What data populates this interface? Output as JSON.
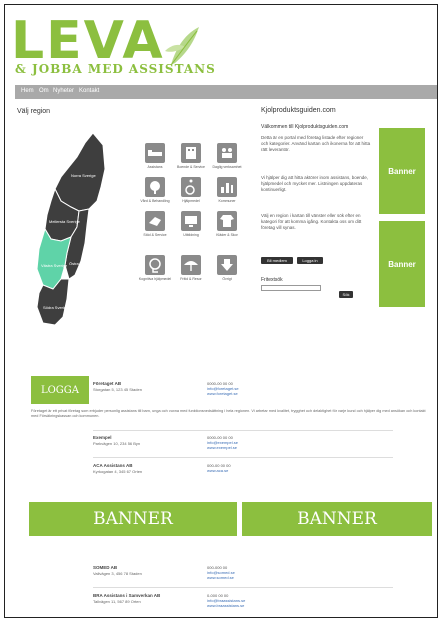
{
  "header": {
    "logo_main": "LEVA",
    "logo_sub": "& JOBBA MED ASSISTANS"
  },
  "nav": {
    "items": [
      "Hem",
      "Om",
      "Nyheter",
      "Kontakt"
    ]
  },
  "left": {
    "region_title": "Välj region",
    "regions": [
      "Norra Sverige",
      "Mellersta Sverige",
      "Västra Sverige",
      "Östra Sverige",
      "Södra Sverige"
    ]
  },
  "icons": [
    {
      "name": "bed-icon",
      "label": "Assistans"
    },
    {
      "name": "building-icon",
      "label": "Boende & Service"
    },
    {
      "name": "people-icon",
      "label": "Daglig verksamhet"
    },
    {
      "name": "medical-icon",
      "label": "Vård & Behandling"
    },
    {
      "name": "wheelchair-icon",
      "label": "Hjälpmedel"
    },
    {
      "name": "chart-icon",
      "label": "Kommuner"
    },
    {
      "name": "hand-icon",
      "label": "Stöd & Service"
    },
    {
      "name": "computer-icon",
      "label": "Utbildning"
    },
    {
      "name": "shirt-icon",
      "label": "Kläder & Skor"
    },
    {
      "name": "head-icon",
      "label": "Kognitiva hjälpmedel"
    },
    {
      "name": "umbrella-icon",
      "label": "Fritid & Resor"
    },
    {
      "name": "misc-icon",
      "label": "Övrigt"
    }
  ],
  "right": {
    "site_title": "Kjolproduktsguiden.com",
    "welcome": "Välkommen till Kjolproduktsguiden.com",
    "paragraphs": [
      "Detta är en portal med företag listade efter regioner och kategorier. Använd kartan och ikonerna för att hitta rätt leverantör.",
      "Vi hjälper dig att hitta aktörer inom assistans, boende, hjälpmedel och mycket mer. Listningen uppdateras kontinuerligt.",
      "Välj en region i kartan till vänster eller sök efter en kategori för att komma igång. Kontakta oss om ditt företag vill synas."
    ],
    "btn_register": "Bli medlem",
    "btn_login": "Logga in",
    "search_label": "Fritextsök",
    "search_btn": "Sök",
    "banner1": "Banner",
    "banner2": "Banner"
  },
  "listings": {
    "logo_box": "LOGGA",
    "items": [
      {
        "name": "Företaget AB",
        "addr": "Storgatan 5, 123 45 Staden",
        "phone": "0000-00 00 00",
        "email": "info@foretaget.se",
        "web": "www.foretaget.se",
        "desc": "Företaget är ett privat företag som erbjuder personlig assistans till barn, unga och vuxna med funktionsnedsättning i hela regionen. Vi arbetar med kvalitet, trygghet och delaktighet för varje kund och hjälper dig med ansökan och kontakt med Försäkringskassan och kommunen."
      },
      {
        "name": "Exempel",
        "addr": "Parkvägen 10, 234 56 Byn",
        "phone": "0000-00 00 00",
        "email": "info@exempel.se",
        "web": "www.exempel.se",
        "desc": ""
      },
      {
        "name": "ACA Assistans AB",
        "addr": "Kyrkogatan 4, 345 67 Orten",
        "phone": "000-00 00 00",
        "email": "",
        "web": "www.aca.se",
        "desc": ""
      },
      {
        "name": "SOMED AB",
        "addr": "Vallvägen 3, 456 78 Staden",
        "phone": "000-000 00",
        "email": "info@somed.se",
        "web": "www.somed.se",
        "desc": ""
      },
      {
        "name": "BRA Assistans i Samverkan AB",
        "addr": "Tallvägen 11, 567 89 Orten",
        "phone": "0-000 00 00",
        "email": "info@braassistans.se",
        "web": "www.braassistans.se",
        "desc": ""
      }
    ],
    "banner_left": "BANNER",
    "banner_right": "BANNER"
  },
  "colors": {
    "accent": "#8cbf3f",
    "map_dark": "#3e3e3e",
    "map_highlight": "#5fd3a8"
  }
}
